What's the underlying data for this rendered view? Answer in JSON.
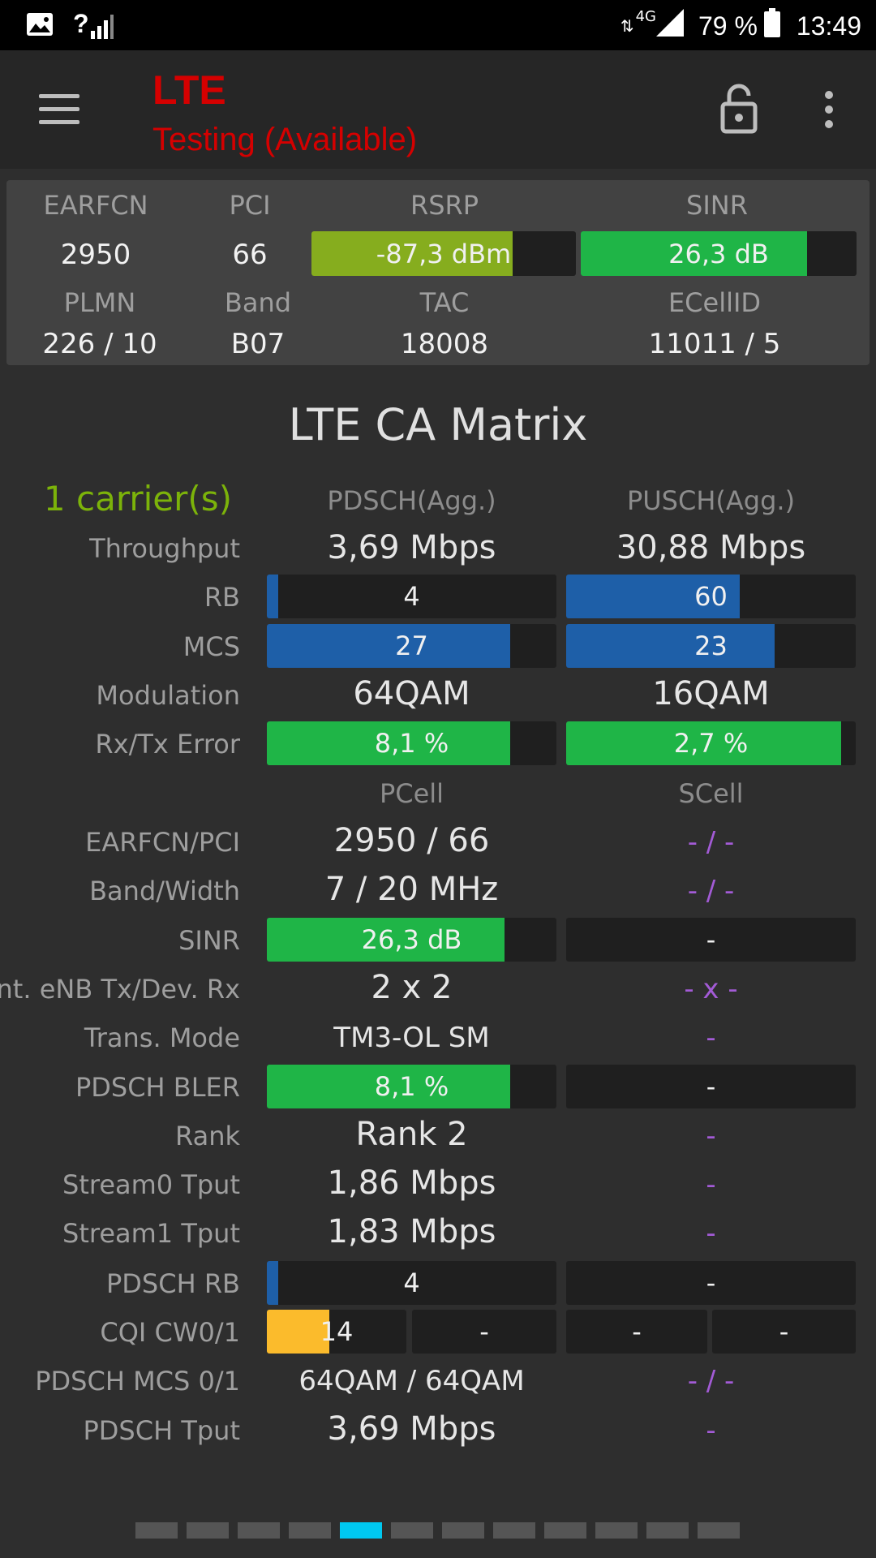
{
  "status_bar": {
    "signal_indicator": "?",
    "network_type": "4G",
    "battery": "79 %",
    "time": "13:49"
  },
  "app_bar": {
    "title": "LTE",
    "subtitle": "Testing (Available)"
  },
  "summary": {
    "earfcn_label": "EARFCN",
    "earfcn": "2950",
    "pci_label": "PCI",
    "pci": "66",
    "rsrp_label": "RSRP",
    "rsrp": "-87,3 dBm",
    "rsrp_fill": 0.76,
    "rsrp_color": "#86ad1e",
    "sinr_label": "SINR",
    "sinr": "26,3 dB",
    "sinr_fill": 0.82,
    "sinr_color": "#1fb547",
    "plmn_label": "PLMN",
    "plmn": "226 / 10",
    "band_label": "Band",
    "band": "B07",
    "tac_label": "TAC",
    "tac": "18008",
    "ecellid_label": "ECellID",
    "ecellid": "11011 / 5"
  },
  "matrix": {
    "title": "LTE CA Matrix",
    "carriers": "1 carrier(s)",
    "pdsch_header": "PDSCH(Agg.)",
    "pusch_header": "PUSCH(Agg.)",
    "throughput_label": "Throughput",
    "throughput_dl": "3,69 Mbps",
    "throughput_ul": "30,88 Mbps",
    "rb_label": "RB",
    "rb_dl": "4",
    "rb_dl_fill": 0.04,
    "rb_ul": "60",
    "rb_ul_fill": 0.6,
    "mcs_label": "MCS",
    "mcs_dl": "27",
    "mcs_dl_fill": 0.84,
    "mcs_ul": "23",
    "mcs_ul_fill": 0.72,
    "modulation_label": "Modulation",
    "modulation_dl": "64QAM",
    "modulation_ul": "16QAM",
    "error_label": "Rx/Tx Error",
    "error_dl": "8,1 %",
    "error_dl_fill": 0.84,
    "error_ul": "2,7 %",
    "error_ul_fill": 0.95,
    "pcell_header": "PCell",
    "scell_header": "SCell",
    "earfcn_pci_label": "EARFCN/PCI",
    "earfcn_pci_p": "2950 / 66",
    "earfcn_pci_s": "- / -",
    "band_width_label": "Band/Width",
    "band_width_p": "7 / 20 MHz",
    "band_width_s": "- / -",
    "sinr_label": "SINR",
    "sinr_p": "26,3 dB",
    "sinr_p_fill": 0.82,
    "sinr_s": "-",
    "ant_label": "Ant. eNB Tx/Dev. Rx",
    "ant_p": "2 x 2",
    "ant_s": "- x -",
    "trans_mode_label": "Trans. Mode",
    "trans_mode_p": "TM3-OL SM",
    "trans_mode_s": "-",
    "bler_label": "PDSCH BLER",
    "bler_p": "8,1 %",
    "bler_p_fill": 0.84,
    "bler_s": "-",
    "rank_label": "Rank",
    "rank_p": "Rank 2",
    "rank_s": "-",
    "stream0_label": "Stream0 Tput",
    "stream0_p": "1,86 Mbps",
    "stream0_s": "-",
    "stream1_label": "Stream1 Tput",
    "stream1_p": "1,83 Mbps",
    "stream1_s": "-",
    "pdsch_rb_label": "PDSCH RB",
    "pdsch_rb_p": "4",
    "pdsch_rb_p_fill": 0.04,
    "pdsch_rb_s": "-",
    "cqi_label": "CQI CW0/1",
    "cqi_p0": "14",
    "cqi_p0_fill": 0.45,
    "cqi_p1": "-",
    "cqi_s0": "-",
    "cqi_s1": "-",
    "pdsch_mcs_label": "PDSCH MCS 0/1",
    "pdsch_mcs_p": "64QAM / 64QAM",
    "pdsch_mcs_s": "- / -",
    "pdsch_tput_label": "PDSCH Tput",
    "pdsch_tput_p": "3,69 Mbps",
    "pdsch_tput_s": "-"
  },
  "colors": {
    "green": "#1fb547",
    "blue": "#1e5fa8",
    "orange": "#fbbb2c",
    "accent_red": "#d50000",
    "page_dot_active": "#00c8f0"
  },
  "pager": {
    "page_count": 12,
    "active_page": 5
  }
}
